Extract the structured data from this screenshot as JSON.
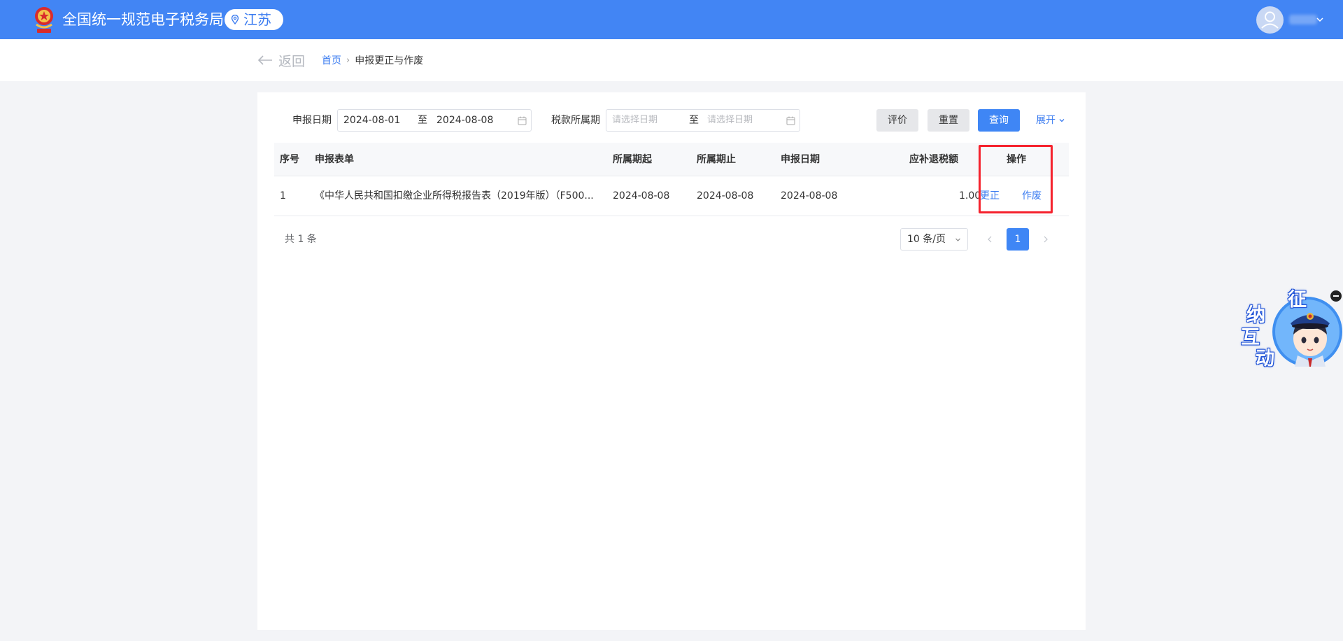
{
  "header": {
    "site_title": "全国统一规范电子税务局",
    "region": "江苏",
    "colors": {
      "bar": "#4285f4",
      "accent": "#3a7bf0"
    }
  },
  "nav": {
    "back_label": "返回",
    "breadcrumb": {
      "home": "首页",
      "separator": "›",
      "current": "申报更正与作废"
    }
  },
  "filters": {
    "declare_date": {
      "label": "申报日期",
      "start": "2024-08-01",
      "to": "至",
      "end": "2024-08-08"
    },
    "tax_period": {
      "label": "税款所属期",
      "start_placeholder": "请选择日期",
      "to": "至",
      "end_placeholder": "请选择日期"
    },
    "buttons": {
      "evaluate": "评价",
      "reset": "重置",
      "query": "查询",
      "expand": "展开"
    }
  },
  "table": {
    "columns": {
      "seq": "序号",
      "form": "申报表单",
      "period_start": "所属期起",
      "period_end": "所属期止",
      "declare_date": "申报日期",
      "amount": "应补退税额",
      "actions": "操作"
    },
    "rows": [
      {
        "seq": "1",
        "form": "《中华人民共和国扣缴企业所得税报告表（2019年版）（F500...",
        "period_start": "2024-08-08",
        "period_end": "2024-08-08",
        "declare_date": "2024-08-08",
        "amount": "1.00",
        "action_correct": "更正",
        "action_void": "作废"
      }
    ]
  },
  "pagination": {
    "total": "共 1 条",
    "page_size": "10 条/页",
    "current_page": "1"
  },
  "widget": {
    "chars": [
      "征",
      "纳",
      "互",
      "动"
    ],
    "icon": "assistant-mascot-icon"
  }
}
